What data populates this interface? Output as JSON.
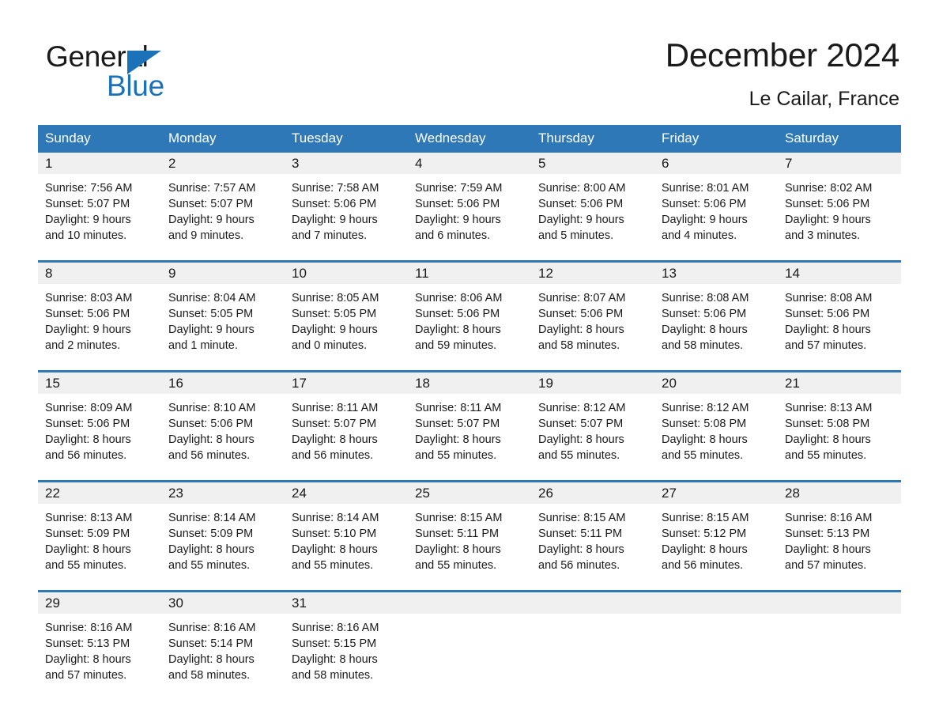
{
  "brand": {
    "logo_line1": "General",
    "logo_line2": "Blue",
    "logo_black": "#1a1a1a",
    "logo_blue": "#1b72b8"
  },
  "header": {
    "title": "December 2024",
    "subtitle": "Le Cailar, France"
  },
  "theme": {
    "header_blue": "#2e78b8",
    "daynum_band": "#f0f0f0",
    "text": "#1a1a1a"
  },
  "weekdays": [
    "Sunday",
    "Monday",
    "Tuesday",
    "Wednesday",
    "Thursday",
    "Friday",
    "Saturday"
  ],
  "weeks": [
    [
      {
        "day": "1",
        "sunrise": "Sunrise: 7:56 AM",
        "sunset": "Sunset: 5:07 PM",
        "daylight1": "Daylight: 9 hours",
        "daylight2": "and 10 minutes."
      },
      {
        "day": "2",
        "sunrise": "Sunrise: 7:57 AM",
        "sunset": "Sunset: 5:07 PM",
        "daylight1": "Daylight: 9 hours",
        "daylight2": "and 9 minutes."
      },
      {
        "day": "3",
        "sunrise": "Sunrise: 7:58 AM",
        "sunset": "Sunset: 5:06 PM",
        "daylight1": "Daylight: 9 hours",
        "daylight2": "and 7 minutes."
      },
      {
        "day": "4",
        "sunrise": "Sunrise: 7:59 AM",
        "sunset": "Sunset: 5:06 PM",
        "daylight1": "Daylight: 9 hours",
        "daylight2": "and 6 minutes."
      },
      {
        "day": "5",
        "sunrise": "Sunrise: 8:00 AM",
        "sunset": "Sunset: 5:06 PM",
        "daylight1": "Daylight: 9 hours",
        "daylight2": "and 5 minutes."
      },
      {
        "day": "6",
        "sunrise": "Sunrise: 8:01 AM",
        "sunset": "Sunset: 5:06 PM",
        "daylight1": "Daylight: 9 hours",
        "daylight2": "and 4 minutes."
      },
      {
        "day": "7",
        "sunrise": "Sunrise: 8:02 AM",
        "sunset": "Sunset: 5:06 PM",
        "daylight1": "Daylight: 9 hours",
        "daylight2": "and 3 minutes."
      }
    ],
    [
      {
        "day": "8",
        "sunrise": "Sunrise: 8:03 AM",
        "sunset": "Sunset: 5:06 PM",
        "daylight1": "Daylight: 9 hours",
        "daylight2": "and 2 minutes."
      },
      {
        "day": "9",
        "sunrise": "Sunrise: 8:04 AM",
        "sunset": "Sunset: 5:05 PM",
        "daylight1": "Daylight: 9 hours",
        "daylight2": "and 1 minute."
      },
      {
        "day": "10",
        "sunrise": "Sunrise: 8:05 AM",
        "sunset": "Sunset: 5:05 PM",
        "daylight1": "Daylight: 9 hours",
        "daylight2": "and 0 minutes."
      },
      {
        "day": "11",
        "sunrise": "Sunrise: 8:06 AM",
        "sunset": "Sunset: 5:06 PM",
        "daylight1": "Daylight: 8 hours",
        "daylight2": "and 59 minutes."
      },
      {
        "day": "12",
        "sunrise": "Sunrise: 8:07 AM",
        "sunset": "Sunset: 5:06 PM",
        "daylight1": "Daylight: 8 hours",
        "daylight2": "and 58 minutes."
      },
      {
        "day": "13",
        "sunrise": "Sunrise: 8:08 AM",
        "sunset": "Sunset: 5:06 PM",
        "daylight1": "Daylight: 8 hours",
        "daylight2": "and 58 minutes."
      },
      {
        "day": "14",
        "sunrise": "Sunrise: 8:08 AM",
        "sunset": "Sunset: 5:06 PM",
        "daylight1": "Daylight: 8 hours",
        "daylight2": "and 57 minutes."
      }
    ],
    [
      {
        "day": "15",
        "sunrise": "Sunrise: 8:09 AM",
        "sunset": "Sunset: 5:06 PM",
        "daylight1": "Daylight: 8 hours",
        "daylight2": "and 56 minutes."
      },
      {
        "day": "16",
        "sunrise": "Sunrise: 8:10 AM",
        "sunset": "Sunset: 5:06 PM",
        "daylight1": "Daylight: 8 hours",
        "daylight2": "and 56 minutes."
      },
      {
        "day": "17",
        "sunrise": "Sunrise: 8:11 AM",
        "sunset": "Sunset: 5:07 PM",
        "daylight1": "Daylight: 8 hours",
        "daylight2": "and 56 minutes."
      },
      {
        "day": "18",
        "sunrise": "Sunrise: 8:11 AM",
        "sunset": "Sunset: 5:07 PM",
        "daylight1": "Daylight: 8 hours",
        "daylight2": "and 55 minutes."
      },
      {
        "day": "19",
        "sunrise": "Sunrise: 8:12 AM",
        "sunset": "Sunset: 5:07 PM",
        "daylight1": "Daylight: 8 hours",
        "daylight2": "and 55 minutes."
      },
      {
        "day": "20",
        "sunrise": "Sunrise: 8:12 AM",
        "sunset": "Sunset: 5:08 PM",
        "daylight1": "Daylight: 8 hours",
        "daylight2": "and 55 minutes."
      },
      {
        "day": "21",
        "sunrise": "Sunrise: 8:13 AM",
        "sunset": "Sunset: 5:08 PM",
        "daylight1": "Daylight: 8 hours",
        "daylight2": "and 55 minutes."
      }
    ],
    [
      {
        "day": "22",
        "sunrise": "Sunrise: 8:13 AM",
        "sunset": "Sunset: 5:09 PM",
        "daylight1": "Daylight: 8 hours",
        "daylight2": "and 55 minutes."
      },
      {
        "day": "23",
        "sunrise": "Sunrise: 8:14 AM",
        "sunset": "Sunset: 5:09 PM",
        "daylight1": "Daylight: 8 hours",
        "daylight2": "and 55 minutes."
      },
      {
        "day": "24",
        "sunrise": "Sunrise: 8:14 AM",
        "sunset": "Sunset: 5:10 PM",
        "daylight1": "Daylight: 8 hours",
        "daylight2": "and 55 minutes."
      },
      {
        "day": "25",
        "sunrise": "Sunrise: 8:15 AM",
        "sunset": "Sunset: 5:11 PM",
        "daylight1": "Daylight: 8 hours",
        "daylight2": "and 55 minutes."
      },
      {
        "day": "26",
        "sunrise": "Sunrise: 8:15 AM",
        "sunset": "Sunset: 5:11 PM",
        "daylight1": "Daylight: 8 hours",
        "daylight2": "and 56 minutes."
      },
      {
        "day": "27",
        "sunrise": "Sunrise: 8:15 AM",
        "sunset": "Sunset: 5:12 PM",
        "daylight1": "Daylight: 8 hours",
        "daylight2": "and 56 minutes."
      },
      {
        "day": "28",
        "sunrise": "Sunrise: 8:16 AM",
        "sunset": "Sunset: 5:13 PM",
        "daylight1": "Daylight: 8 hours",
        "daylight2": "and 57 minutes."
      }
    ],
    [
      {
        "day": "29",
        "sunrise": "Sunrise: 8:16 AM",
        "sunset": "Sunset: 5:13 PM",
        "daylight1": "Daylight: 8 hours",
        "daylight2": "and 57 minutes."
      },
      {
        "day": "30",
        "sunrise": "Sunrise: 8:16 AM",
        "sunset": "Sunset: 5:14 PM",
        "daylight1": "Daylight: 8 hours",
        "daylight2": "and 58 minutes."
      },
      {
        "day": "31",
        "sunrise": "Sunrise: 8:16 AM",
        "sunset": "Sunset: 5:15 PM",
        "daylight1": "Daylight: 8 hours",
        "daylight2": "and 58 minutes."
      },
      {
        "day": "",
        "sunrise": "",
        "sunset": "",
        "daylight1": "",
        "daylight2": ""
      },
      {
        "day": "",
        "sunrise": "",
        "sunset": "",
        "daylight1": "",
        "daylight2": ""
      },
      {
        "day": "",
        "sunrise": "",
        "sunset": "",
        "daylight1": "",
        "daylight2": ""
      },
      {
        "day": "",
        "sunrise": "",
        "sunset": "",
        "daylight1": "",
        "daylight2": ""
      }
    ]
  ]
}
